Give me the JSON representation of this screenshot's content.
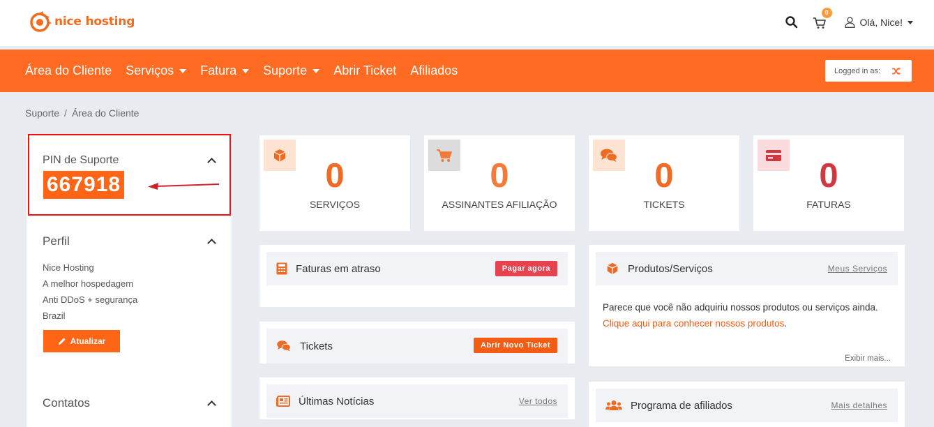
{
  "brand": {
    "name": "nice hosting",
    "accent": "#ff6b22"
  },
  "header": {
    "cart_count": "0",
    "user_greeting": "Olá, Nice!"
  },
  "nav": {
    "items": [
      "Área do Cliente",
      "Serviços",
      "Fatura",
      "Suporte",
      "Abrir Ticket",
      "Afiliados"
    ],
    "logged_in_label": "Logged in as:"
  },
  "breadcrumb": {
    "parent": "Suporte",
    "current": "Área do Cliente"
  },
  "sidebar": {
    "pin_title": "PIN de Suporte",
    "pin_value": "667918",
    "profile_title": "Perfil",
    "profile_lines": [
      "Nice Hosting",
      "A melhor hospedagem",
      "Anti DDoS + segurança",
      "Brazil"
    ],
    "update_button": "Atualizar",
    "contacts_title": "Contatos"
  },
  "stats": [
    {
      "value": "0",
      "label": "SERVIÇOS",
      "icon": "cube-icon",
      "color": "#f06a26"
    },
    {
      "value": "0",
      "label": "ASSINANTES AFILIAÇÃO",
      "icon": "cart-icon",
      "color": "#f47a3a"
    },
    {
      "value": "0",
      "label": "TICKETS",
      "icon": "comments-icon",
      "color": "#f06a26"
    },
    {
      "value": "0",
      "label": "FATURAS",
      "icon": "credit-card-icon",
      "color": "#d0383f"
    }
  ],
  "panels": {
    "overdue": {
      "title": "Faturas em atraso",
      "action": "Pagar agora"
    },
    "tickets": {
      "title": "Tickets",
      "action": "Abrir Novo Ticket"
    },
    "news": {
      "title": "Últimas Notícias",
      "action": "Ver todos"
    },
    "products": {
      "title": "Produtos/Serviços",
      "action": "Meus Serviços",
      "text": "Parece que você não adquiriu nossos produtos ou serviços ainda.",
      "link": "Clique aqui para conhecer nossos produtos",
      "more": "Exibir mais..."
    },
    "affiliates": {
      "title": "Programa de afiliados",
      "action": "Mais detalhes"
    }
  }
}
